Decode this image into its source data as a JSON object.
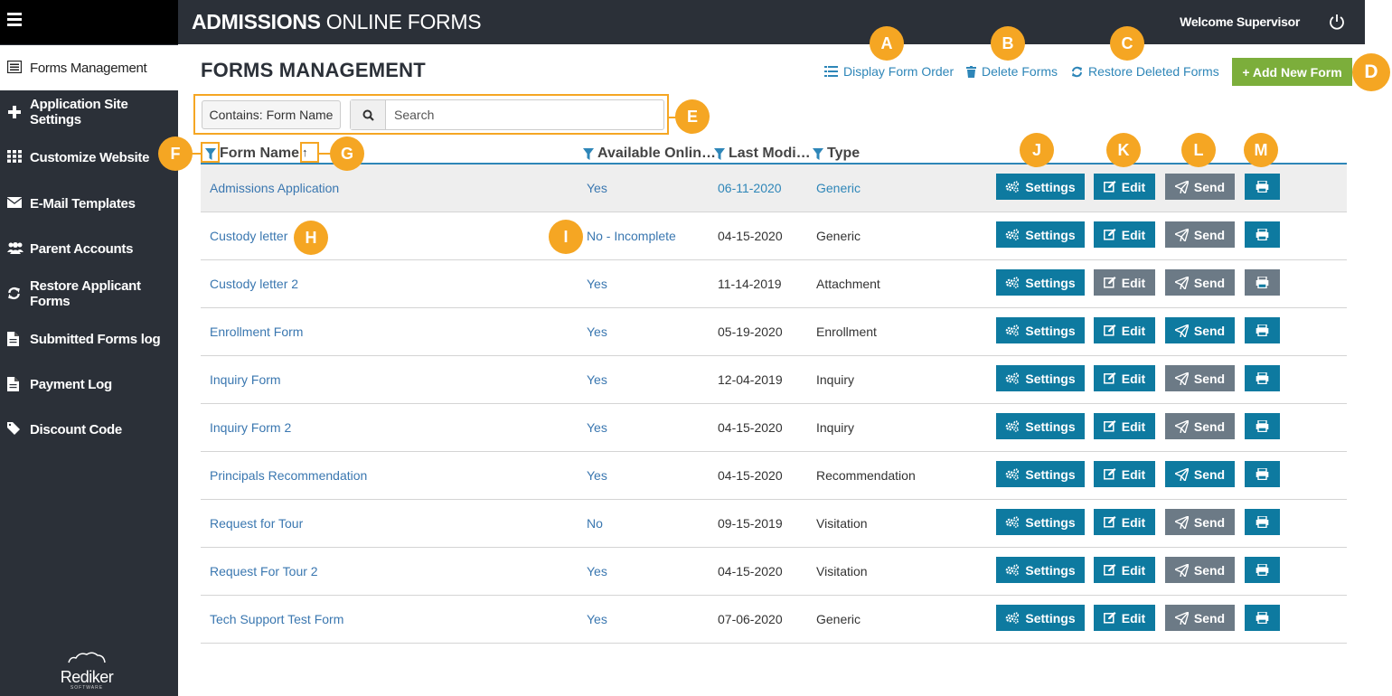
{
  "sidebar": {
    "menu_icon": "hamburger-menu-icon",
    "items": [
      {
        "label": "Forms Management",
        "icon": "list-icon"
      },
      {
        "label": "Application Site Settings",
        "icon": "plus-icon"
      },
      {
        "label": "Customize Website",
        "icon": "grid-icon"
      },
      {
        "label": "E-Mail Templates",
        "icon": "envelope-icon"
      },
      {
        "label": "Parent Accounts",
        "icon": "users-icon"
      },
      {
        "label": "Restore Applicant Forms",
        "icon": "refresh-icon"
      },
      {
        "label": "Submitted Forms log",
        "icon": "document-icon"
      },
      {
        "label": "Payment Log",
        "icon": "document-icon"
      },
      {
        "label": "Discount Code",
        "icon": "tag-icon"
      }
    ],
    "logo": {
      "word": "Rediker",
      "sub": "SOFTWARE"
    }
  },
  "header": {
    "title_bold": "ADMISSIONS",
    "title_rest": "ONLINE FORMS",
    "welcome": "Welcome Supervisor",
    "power_icon": "power-icon"
  },
  "page": {
    "title": "FORMS MANAGEMENT",
    "links": {
      "display_order": "Display Form Order",
      "delete": "Delete Forms",
      "restore": "Restore Deleted Forms"
    },
    "add_button": "+ Add New Form"
  },
  "search": {
    "contains": "Contains: Form Name",
    "placeholder": "Search"
  },
  "table": {
    "headers": {
      "name": "Form Name",
      "available": "Available Onlin…",
      "modified": "Last Modi…",
      "type": "Type"
    },
    "sort_indicator": "↑",
    "rows": [
      {
        "name": "Admissions Application",
        "available": "Yes",
        "date": "06-11-2020",
        "type": "Generic"
      },
      {
        "name": "Custody letter",
        "available": "No - Incomplete",
        "date": "04-15-2020",
        "type": "Generic"
      },
      {
        "name": "Custody letter 2",
        "available": "Yes",
        "date": "11-14-2019",
        "type": "Attachment"
      },
      {
        "name": "Enrollment Form",
        "available": "Yes",
        "date": "05-19-2020",
        "type": "Enrollment"
      },
      {
        "name": "Inquiry Form",
        "available": "Yes",
        "date": "12-04-2019",
        "type": "Inquiry"
      },
      {
        "name": "Inquiry Form 2",
        "available": "Yes",
        "date": "04-15-2020",
        "type": "Inquiry"
      },
      {
        "name": "Principals Recommendation",
        "available": "Yes",
        "date": "04-15-2020",
        "type": "Recommendation"
      },
      {
        "name": "Request for Tour",
        "available": "No",
        "date": "09-15-2019",
        "type": "Visitation"
      },
      {
        "name": "Request For Tour 2",
        "available": "Yes",
        "date": "04-15-2020",
        "type": "Visitation"
      },
      {
        "name": "Tech Support Test Form",
        "available": "Yes",
        "date": "07-06-2020",
        "type": "Generic"
      }
    ],
    "actions": {
      "settings": "Settings",
      "edit": "Edit",
      "send": "Send"
    }
  },
  "callouts": [
    "A",
    "B",
    "C",
    "D",
    "E",
    "F",
    "G",
    "H",
    "I",
    "J",
    "K",
    "L",
    "M"
  ],
  "colors": {
    "sidebar_bg": "#2b3038",
    "accent_blue": "#0e7aa0",
    "link_blue": "#3a77b0",
    "send_gray": "#6c7a86",
    "add_green": "#7cae3b",
    "callout_orange": "#f5a623"
  }
}
